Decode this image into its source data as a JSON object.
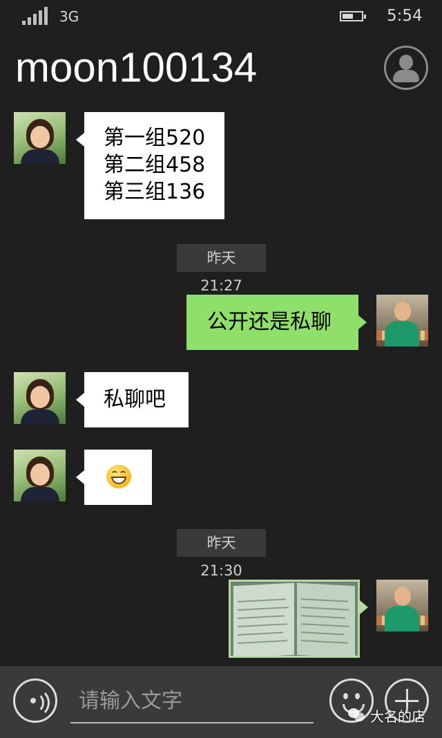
{
  "status_bar": {
    "network": "3G",
    "time": "5:54"
  },
  "header": {
    "contact_name": "moon100134",
    "profile_icon": "person-icon"
  },
  "messages": [
    {
      "from": "contact",
      "lines": [
        "第一组520",
        "第二组458",
        "第三组136"
      ]
    },
    {
      "timestamp": "昨天 21:27"
    },
    {
      "from": "me",
      "text": "公开还是私聊"
    },
    {
      "from": "contact",
      "text": "私聊吧"
    },
    {
      "from": "contact",
      "emoji": "grinning-face-emoji"
    },
    {
      "timestamp": "昨天 21:30"
    },
    {
      "from": "me",
      "image": "book-page-photo"
    }
  ],
  "input_bar": {
    "placeholder": "请输入文字"
  },
  "watermark": {
    "text": "大名的店"
  },
  "colors": {
    "background": "#1f1f1f",
    "incoming_bubble": "#ffffff",
    "outgoing_bubble": "#8ee06a",
    "input_bar": "#3a3a3a"
  }
}
